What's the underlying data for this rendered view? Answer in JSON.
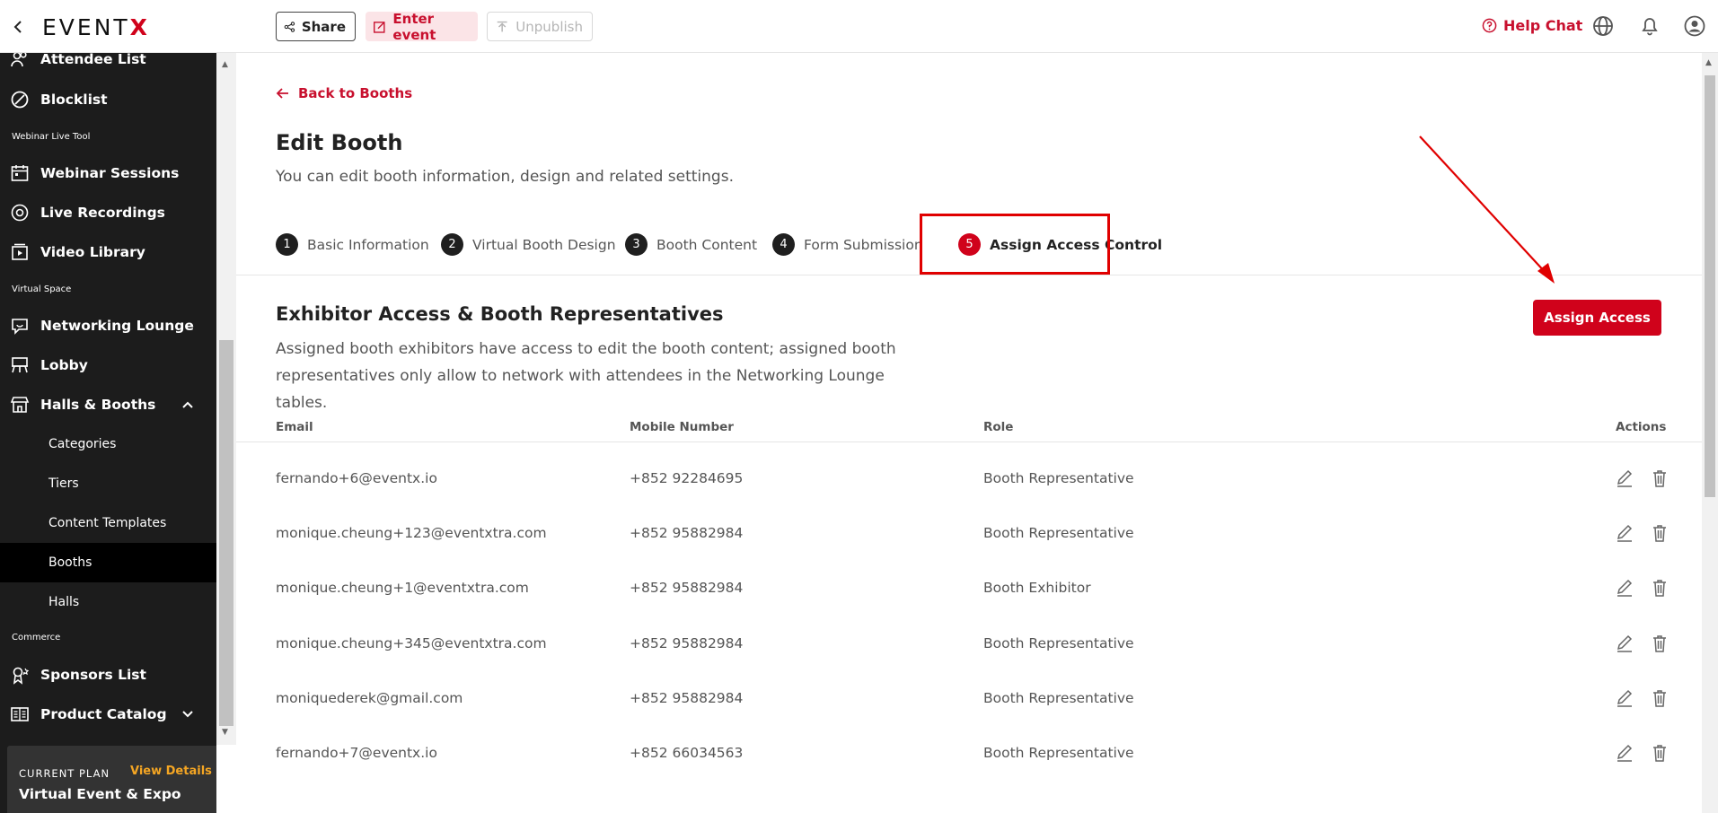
{
  "header": {
    "logo": {
      "main": "EVENT",
      "accent": "X"
    },
    "share_label": "Share",
    "enter_event_label": "Enter event",
    "unpublish_label": "Unpublish",
    "help_chat_label": "Help Chat"
  },
  "sidebar": {
    "items_top": [
      {
        "label": "Attendee List",
        "icon": "users-icon"
      },
      {
        "label": "Blocklist",
        "icon": "block-icon"
      }
    ],
    "section_webinar": "Webinar Live Tool",
    "items_webinar": [
      {
        "label": "Webinar Sessions",
        "icon": "calendar-icon"
      },
      {
        "label": "Live Recordings",
        "icon": "record-icon"
      },
      {
        "label": "Video Library",
        "icon": "video-icon"
      }
    ],
    "section_virtual": "Virtual Space",
    "items_virtual": [
      {
        "label": "Networking Lounge",
        "icon": "chat-icon"
      },
      {
        "label": "Lobby",
        "icon": "lobby-icon"
      },
      {
        "label": "Halls & Booths",
        "icon": "store-icon"
      }
    ],
    "sub_items": [
      {
        "label": "Categories"
      },
      {
        "label": "Tiers"
      },
      {
        "label": "Content Templates"
      },
      {
        "label": "Booths",
        "active": true
      },
      {
        "label": "Halls"
      }
    ],
    "section_commerce": "Commerce",
    "items_commerce": [
      {
        "label": "Sponsors List",
        "icon": "sponsor-icon"
      },
      {
        "label": "Product Catalog",
        "icon": "catalog-icon"
      }
    ],
    "plan": {
      "caption": "CURRENT PLAN",
      "view_details": "View Details",
      "name": "Virtual Event & Expo"
    }
  },
  "page": {
    "back_label": "Back to Booths",
    "title": "Edit Booth",
    "subtitle": "You can edit booth information, design and related settings.",
    "steps": [
      {
        "num": "1",
        "label": "Basic Information"
      },
      {
        "num": "2",
        "label": "Virtual Booth Design"
      },
      {
        "num": "3",
        "label": "Booth Content"
      },
      {
        "num": "4",
        "label": "Form Submission"
      },
      {
        "num": "5",
        "label": "Assign Access Control",
        "active": true
      }
    ],
    "section_title": "Exhibitor Access & Booth Representatives",
    "section_desc": "Assigned booth exhibitors have access to edit the booth content; assigned booth representatives only allow to network with attendees in the Networking Lounge tables.",
    "assign_button": "Assign Access"
  },
  "table": {
    "columns": {
      "email": "Email",
      "mobile": "Mobile Number",
      "role": "Role",
      "actions": "Actions"
    },
    "rows": [
      {
        "email": "fernando+6@eventx.io",
        "mobile": "+852 92284695",
        "role": "Booth Representative"
      },
      {
        "email": "monique.cheung+123@eventxtra.com",
        "mobile": "+852 95882984",
        "role": "Booth Representative"
      },
      {
        "email": "monique.cheung+1@eventxtra.com",
        "mobile": "+852 95882984",
        "role": "Booth Exhibitor"
      },
      {
        "email": "monique.cheung+345@eventxtra.com",
        "mobile": "+852 95882984",
        "role": "Booth Representative"
      },
      {
        "email": "moniquederek@gmail.com",
        "mobile": "+852 95882984",
        "role": "Booth Representative"
      },
      {
        "email": "fernando+7@eventx.io",
        "mobile": "+852 66034563",
        "role": "Booth Representative"
      }
    ]
  },
  "colors": {
    "accent": "#d0021b",
    "sidebar_bg": "#1c1c1c",
    "annotation": "#e00000"
  }
}
